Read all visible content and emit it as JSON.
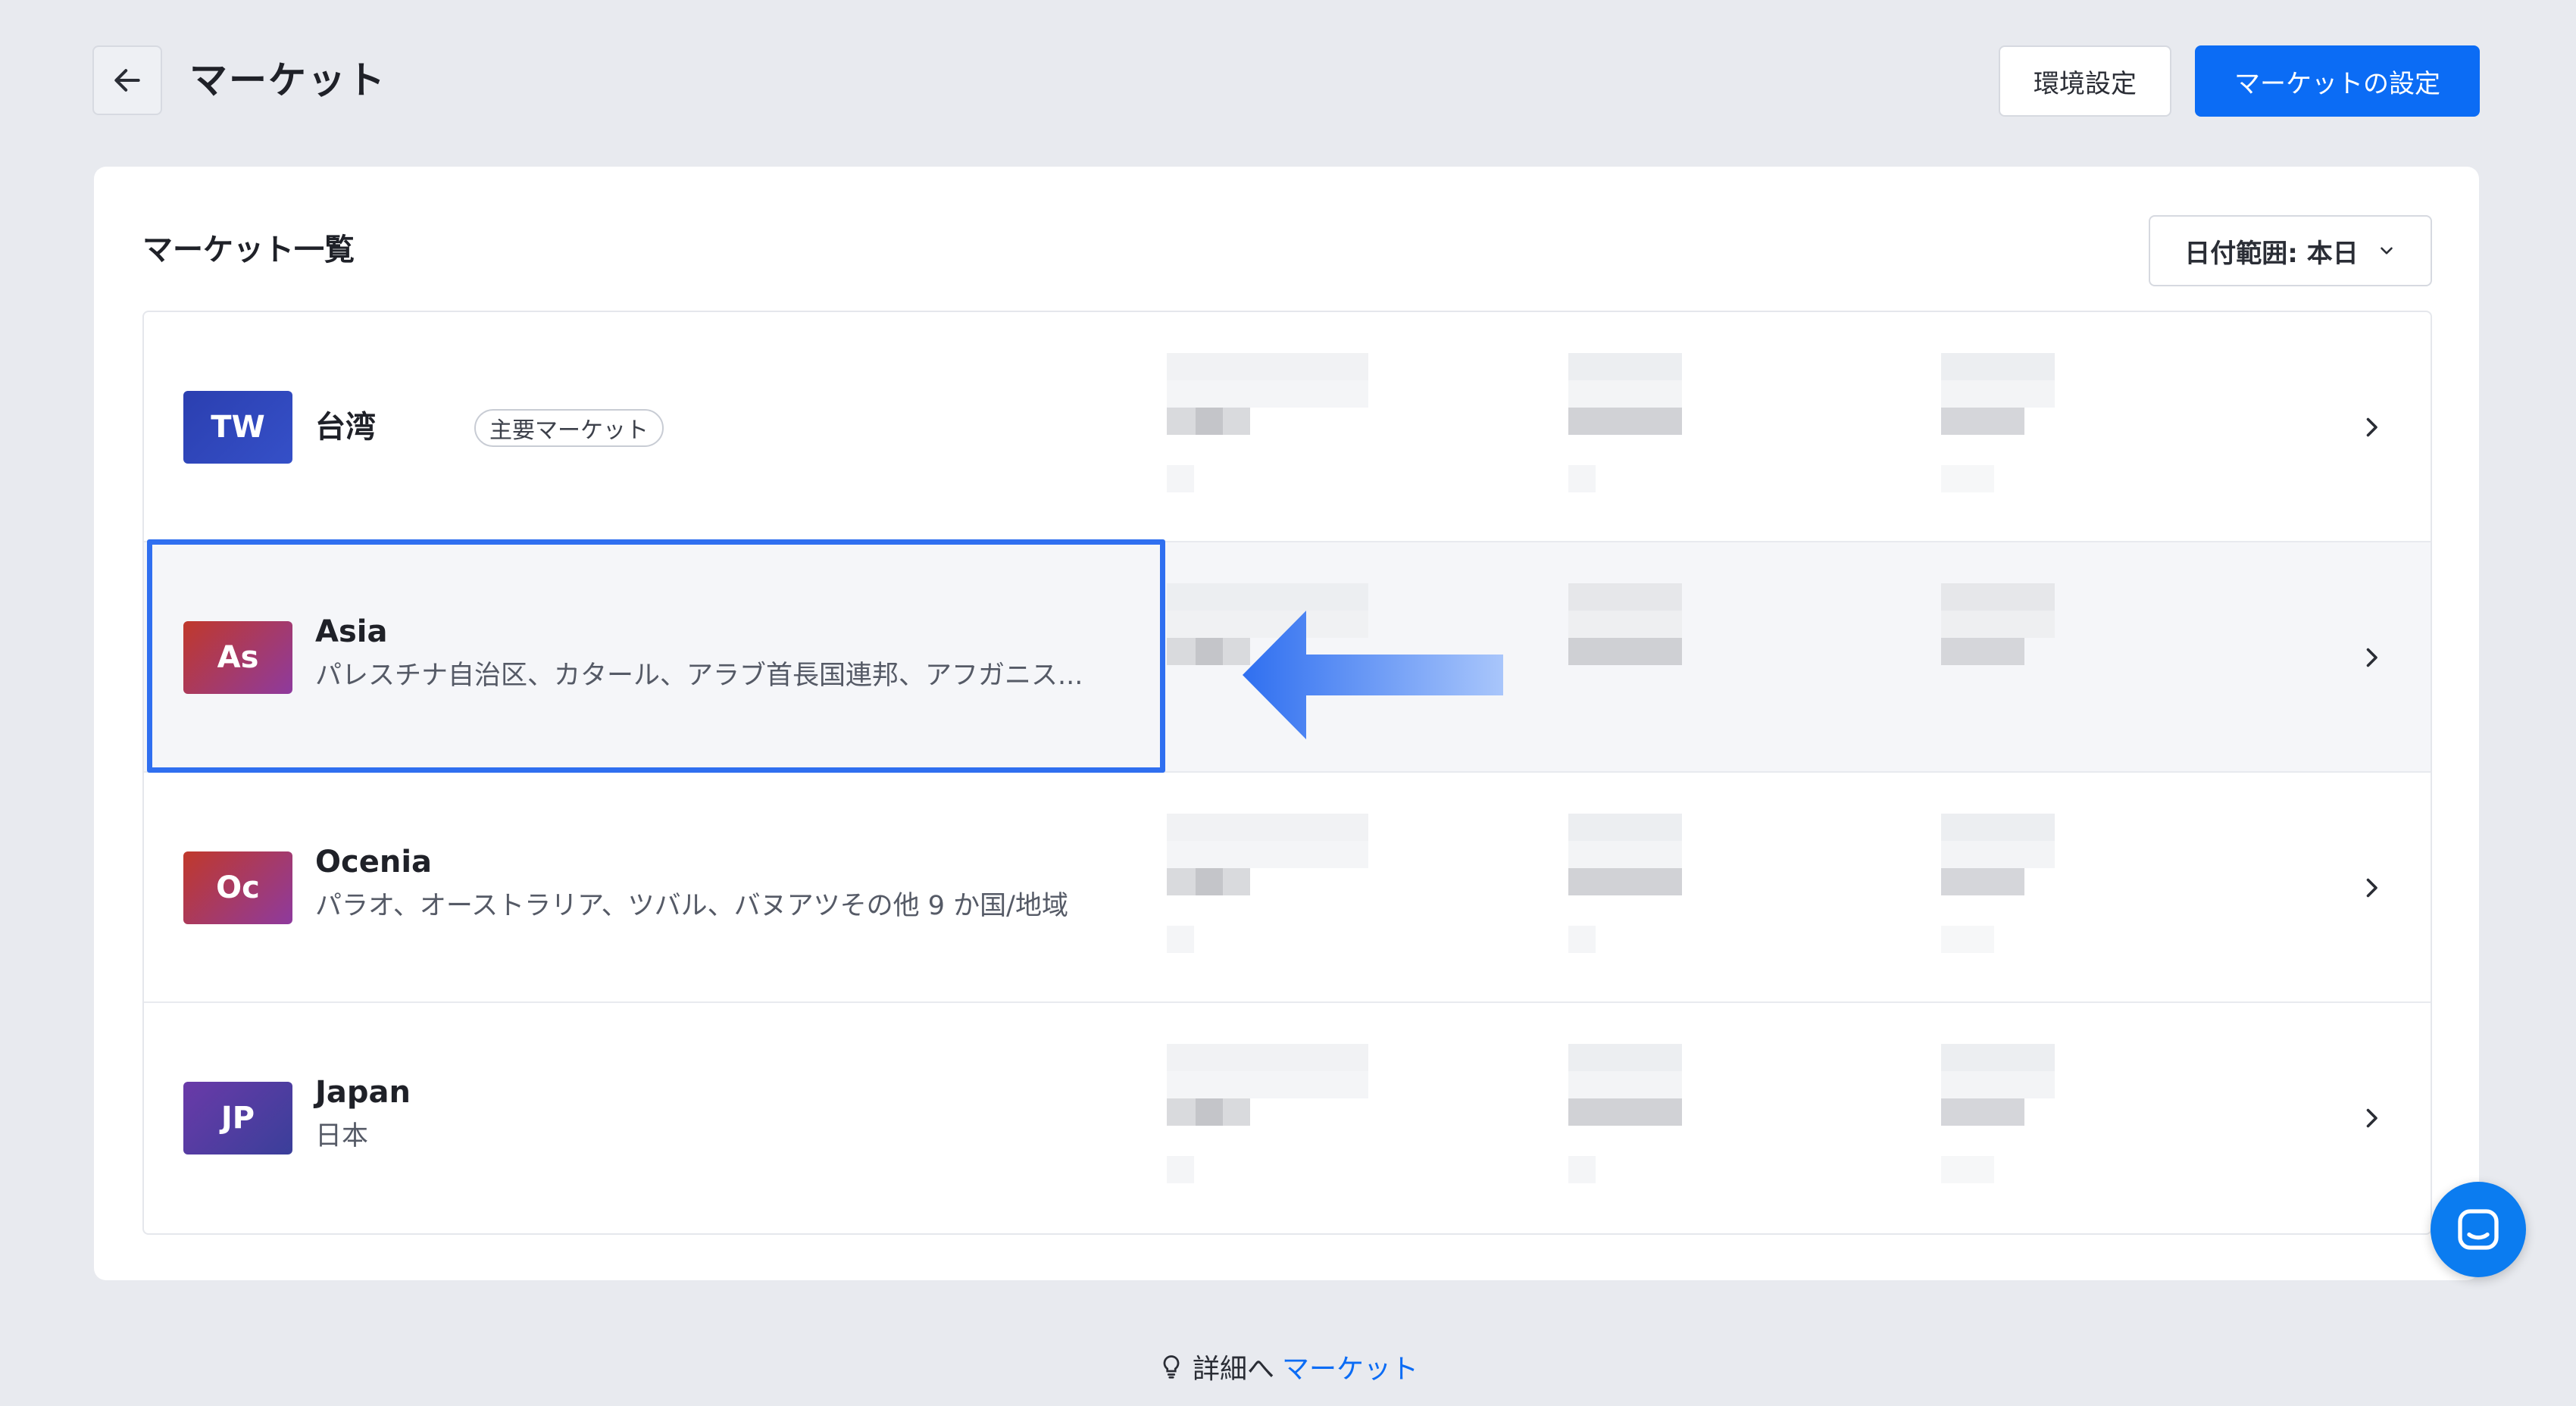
{
  "header": {
    "title": "マーケット",
    "secondary_button": "環境設定",
    "primary_button": "マーケットの設定",
    "accent_color": "#0b6cf5"
  },
  "card": {
    "title": "マーケット一覧",
    "date_filter": "日付範囲: 本日"
  },
  "markets": [
    {
      "badge": "TW",
      "name": "台湾",
      "tag": "主要マーケット",
      "description": "",
      "badge_color": "#2e45b8"
    },
    {
      "badge": "As",
      "name": "Asia",
      "tag": "",
      "description": "パレスチナ自治区、カタール、アラブ首長国連邦、アフガニス...",
      "badge_color": "#b83a4a"
    },
    {
      "badge": "Oc",
      "name": "Ocenia",
      "tag": "",
      "description": "パラオ、オーストラリア、ツバル、バヌアツその他 9 か国/地域",
      "badge_color": "#b83a4a"
    },
    {
      "badge": "JP",
      "name": "Japan",
      "tag": "",
      "description": "日本",
      "badge_color": "#5b3a9e"
    }
  ],
  "footer": {
    "prefix": "詳細へ",
    "link": "マーケット"
  },
  "icons": [
    "back-arrow-icon",
    "chevron-down-icon",
    "chevron-right-icon",
    "lightbulb-icon",
    "chat-icon"
  ]
}
